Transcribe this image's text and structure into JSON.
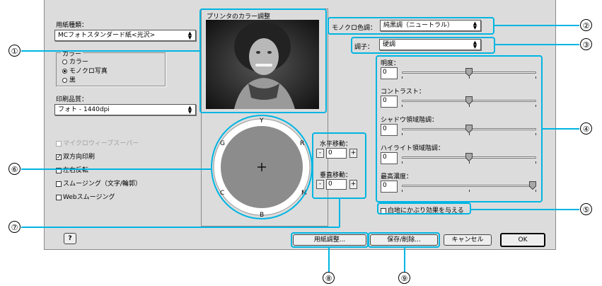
{
  "paper_type": {
    "label": "用紙種類：",
    "value": "MCフォトスタンダード紙<光沢>"
  },
  "color_group": {
    "label": "カラー",
    "options": [
      {
        "label": "カラー",
        "selected": false
      },
      {
        "label": "モノクロ写真",
        "selected": true
      },
      {
        "label": "黒",
        "selected": false
      }
    ]
  },
  "print_quality": {
    "label": "印刷品質：",
    "value": "フォト - 1440dpi"
  },
  "checkboxes": [
    {
      "label": "マイクロウィーブスーパー",
      "checked": false,
      "disabled": true
    },
    {
      "label": "双方向印刷",
      "checked": true,
      "disabled": false
    },
    {
      "label": "左右反転",
      "checked": false,
      "disabled": false
    },
    {
      "label": "スムージング（文字/輪郭）",
      "checked": false,
      "disabled": false
    },
    {
      "label": "Webスムージング",
      "checked": false,
      "disabled": false
    }
  ],
  "help_button": "?",
  "printer_color_adjust": {
    "label": "プリンタのカラー調整"
  },
  "color_wheel": {
    "labels": {
      "top": "Y",
      "top_right": "R",
      "bottom_right": "M",
      "bottom": "B",
      "bottom_left": "C",
      "top_left": "G"
    },
    "center": "+"
  },
  "horizontal_move": {
    "label": "水平移動：",
    "value": "0",
    "minus": "-",
    "plus": "+"
  },
  "vertical_move": {
    "label": "垂直移動：",
    "value": "0",
    "minus": "-",
    "plus": "+"
  },
  "mono_tone": {
    "label": "モノクロ色調：",
    "value": "純黒調（ニュートラル）"
  },
  "tone": {
    "label": "調子：",
    "value": "硬調"
  },
  "sliders": [
    {
      "label": "明度：",
      "value": "0",
      "position": 0.5
    },
    {
      "label": "コントラスト：",
      "value": "0",
      "position": 0.5
    },
    {
      "label": "シャドウ領域階調：",
      "value": "0",
      "position": 0.5
    },
    {
      "label": "ハイライト領域階調：",
      "value": "0",
      "position": 0.5
    },
    {
      "label": "最高濃度：",
      "value": "0",
      "position": 1.0
    }
  ],
  "fog_effect": {
    "label": "白地にかぶり効果を与える",
    "checked": false
  },
  "buttons": {
    "paper_adjust": "用紙調整...",
    "save_delete": "保存/削除...",
    "cancel": "キャンセル",
    "ok": "OK"
  },
  "callouts": [
    "①",
    "②",
    "③",
    "④",
    "⑤",
    "⑥",
    "⑦",
    "⑧",
    "⑨"
  ],
  "colors": {
    "highlight": "#00b5e2",
    "dialog_bg": "#dcdcdc",
    "wheel_gray": "#8c8c8c"
  }
}
